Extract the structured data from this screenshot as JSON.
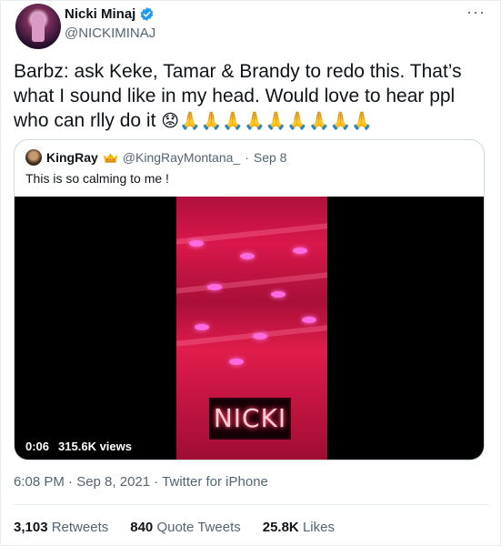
{
  "author": {
    "display_name": "Nicki Minaj",
    "handle": "@NICKIMINAJ",
    "verified": true,
    "avatar_icon": "profile-photo"
  },
  "more_icon": "···",
  "tweet": {
    "text": "Barbz: ask Keke, Tamar & Brandy to redo this. That’s what I sound like in my head. Would love to hear ppl who can rlly do it ",
    "emojis": "😟🙏🙏🙏🙏🙏🙏🙏🙏🙏"
  },
  "quoted": {
    "display_name": "KingRay",
    "crown_icon": "crown-icon",
    "handle": "@KingRayMontana_",
    "separator": "·",
    "date": "Sep 8",
    "text": "This is so calming to me !",
    "video": {
      "neon_sign": "NICKI",
      "time": "0:06",
      "views": "315.6K views"
    }
  },
  "timestamp": "6:08 PM · Sep 8, 2021 · Twitter for iPhone",
  "stats": {
    "retweets_count": "3,103",
    "retweets_label": "Retweets",
    "quotes_count": "840",
    "quotes_label": "Quote Tweets",
    "likes_count": "25.8K",
    "likes_label": "Likes"
  },
  "colors": {
    "verified": "#1d9bf0",
    "secondary_text": "#536471",
    "neon_red": "#d9184a"
  }
}
